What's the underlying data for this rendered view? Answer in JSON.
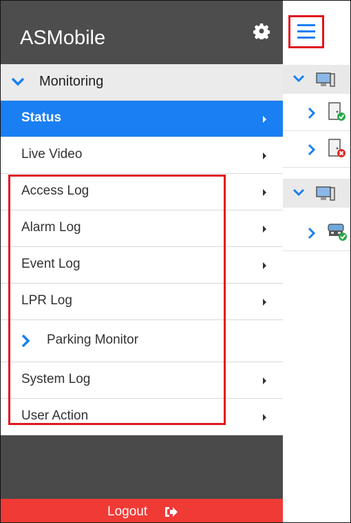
{
  "app": {
    "title": "ASMobile"
  },
  "sidebar": {
    "section": {
      "label": "Monitoring"
    },
    "items": [
      {
        "label": "Status",
        "active": true
      },
      {
        "label": "Live Video"
      },
      {
        "label": "Access Log"
      },
      {
        "label": "Alarm Log"
      },
      {
        "label": "Event Log"
      },
      {
        "label": "LPR Log"
      },
      {
        "label": "Parking Monitor",
        "submenu": true
      },
      {
        "label": "System Log"
      },
      {
        "label": "User Action"
      }
    ],
    "logout_label": "Logout"
  },
  "colors": {
    "accent": "#1a7ff2",
    "sidebar_bg": "#4a4a4a",
    "logout_bg": "#f03a36",
    "highlight": "#e0141f"
  },
  "icons": {
    "settings": "gear-icon",
    "logout": "logout-icon",
    "menu": "hamburger-menu-icon",
    "expand": "chevron-down-icon",
    "submenu": "chevron-right-icon",
    "computer": "computer-icon",
    "door_ok": "door-ok-icon",
    "door_error": "door-error-icon",
    "parking_ok": "parking-device-ok-icon"
  }
}
